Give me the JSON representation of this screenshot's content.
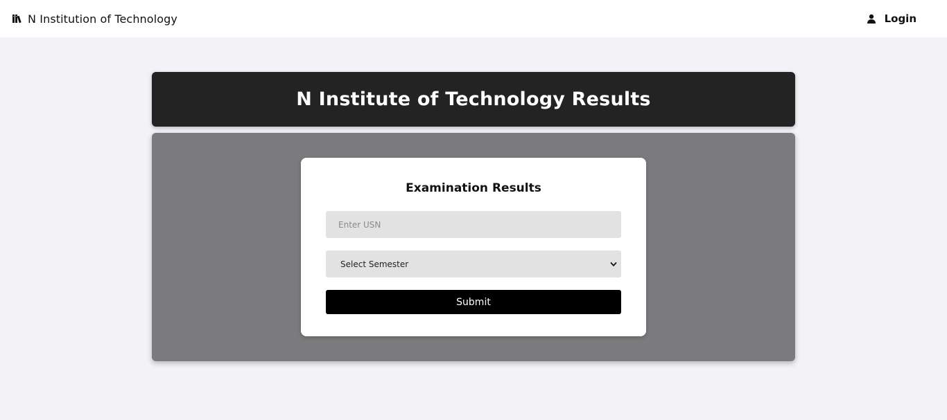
{
  "navbar": {
    "brand_icon": "book-icon",
    "brand_text": "N Institution of Technology",
    "login_icon": "user-icon",
    "login_label": "Login"
  },
  "header": {
    "title": "N Institute of Technology Results"
  },
  "form": {
    "title": "Examination Results",
    "usn": {
      "value": "",
      "placeholder": "Enter USN"
    },
    "semester": {
      "selected": "Select Semester",
      "icon": "chevron-down-icon"
    },
    "submit_label": "Submit"
  },
  "colors": {
    "page_bg": "#f3f3f7",
    "header_bg": "#232323",
    "panel_bg": "#7b7b7e",
    "input_bg": "#e2e2e2",
    "button_bg": "#000000"
  }
}
